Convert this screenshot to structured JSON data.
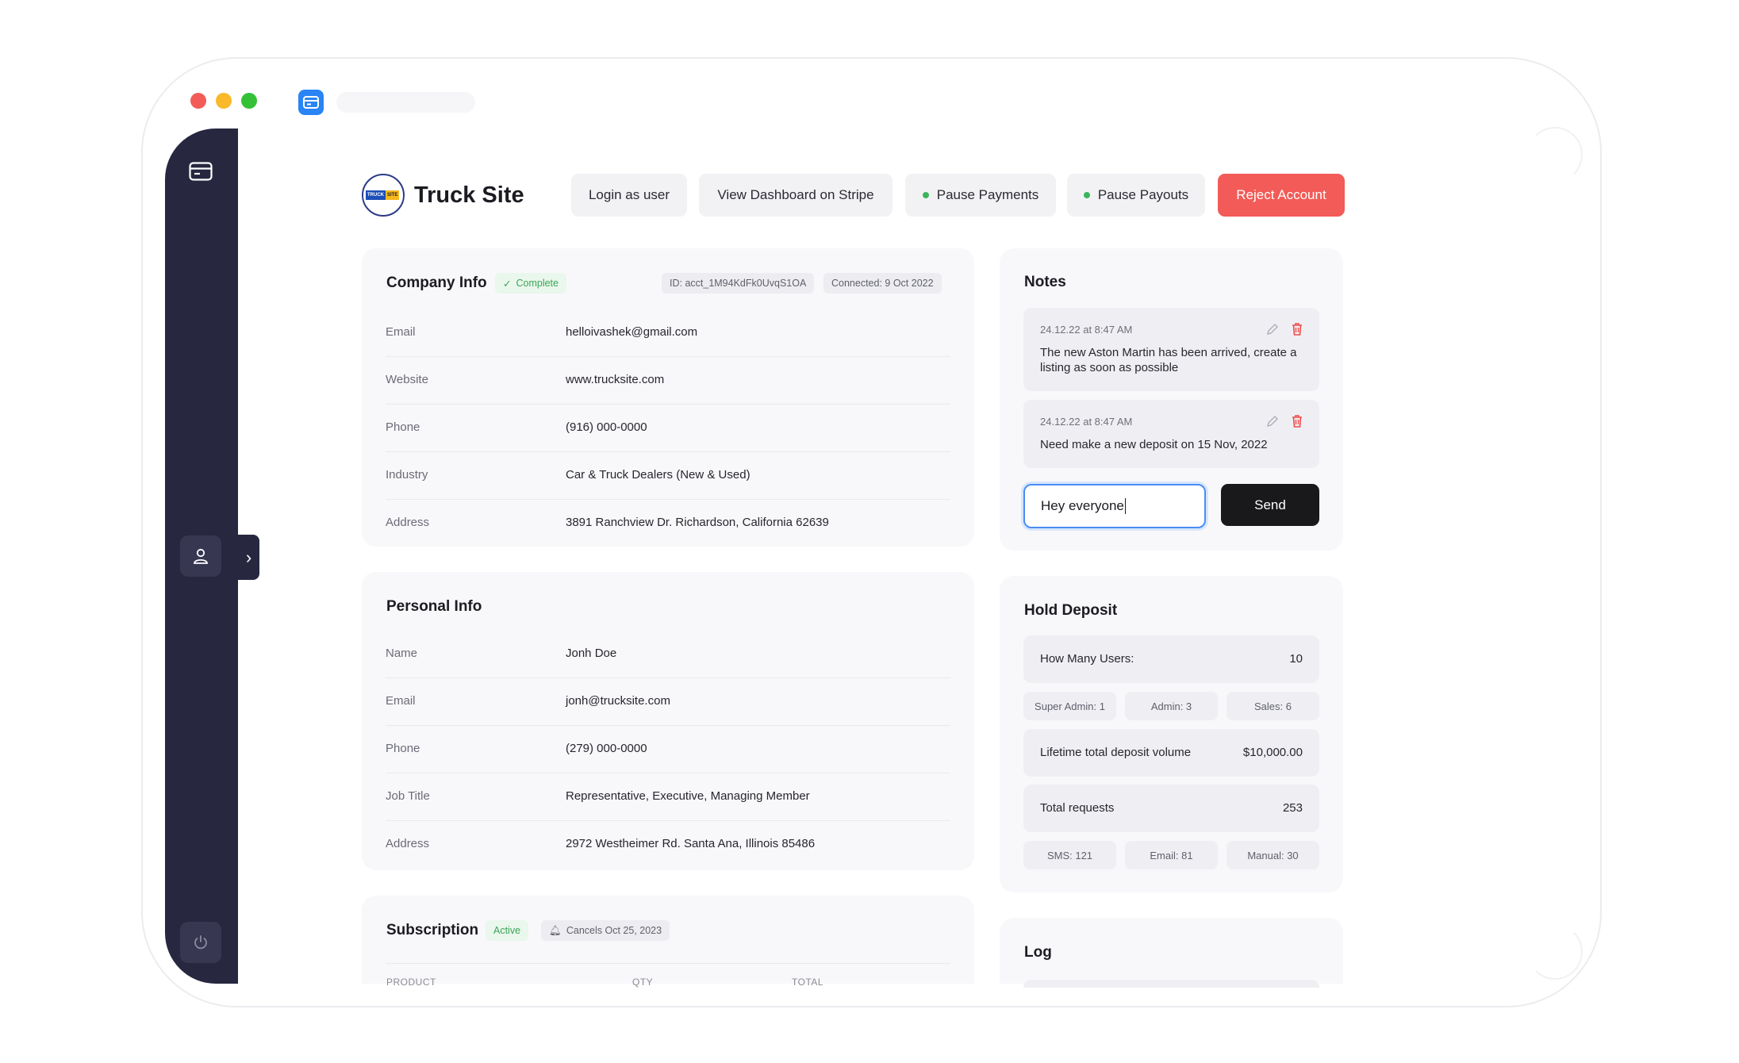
{
  "company": {
    "name": "Truck Site",
    "logo_left": "TRUCK",
    "logo_right": "SITE"
  },
  "actions": {
    "login": "Login as user",
    "stripe": "View Dashboard on Stripe",
    "pause_payments": "Pause Payments",
    "pause_payouts": "Pause Payouts",
    "reject": "Reject Account"
  },
  "company_info": {
    "title": "Company Info",
    "status": "Complete",
    "id": "ID: acct_1M94KdFk0UvqS1OA",
    "connected": "Connected: 9 Oct 2022",
    "rows": [
      {
        "label": "Email",
        "value": "helloivashek@gmail.com"
      },
      {
        "label": "Website",
        "value": "www.trucksite.com"
      },
      {
        "label": "Phone",
        "value": "(916) 000-0000"
      },
      {
        "label": "Industry",
        "value": "Car & Truck Dealers (New & Used)"
      },
      {
        "label": "Address",
        "value": "3891 Ranchview Dr. Richardson, California 62639"
      }
    ]
  },
  "personal_info": {
    "title": "Personal Info",
    "rows": [
      {
        "label": "Name",
        "value": "Jonh Doe"
      },
      {
        "label": "Email",
        "value": "jonh@trucksite.com"
      },
      {
        "label": "Phone",
        "value": "(279) 000-0000"
      },
      {
        "label": "Job Title",
        "value": "Representative, Executive, Managing Member"
      },
      {
        "label": "Address",
        "value": "2972 Westheimer Rd. Santa Ana, Illinois 85486"
      }
    ]
  },
  "subscription": {
    "title": "Subscription",
    "status": "Active",
    "cancels": "Cancels Oct 25, 2023",
    "columns": [
      "PRODUCT",
      "QTY",
      "TOTAL"
    ]
  },
  "notes": {
    "title": "Notes",
    "items": [
      {
        "time": "24.12.22 at 8:47 AM",
        "text": "The new Aston Martin has been arrived, create a listing as soon as possible"
      },
      {
        "time": "24.12.22 at 8:47 AM",
        "text": "Need make a new deposit on 15 Nov, 2022"
      }
    ],
    "input_value": "Hey everyone",
    "send": "Send"
  },
  "hold_deposit": {
    "title": "Hold Deposit",
    "users_label": "How Many Users:",
    "users_value": "10",
    "roles": [
      "Super Admin: 1",
      "Admin: 3",
      "Sales: 6"
    ],
    "lifetime_label": "Lifetime total deposit volume",
    "lifetime_value": "$10,000.00",
    "requests_label": "Total requests",
    "requests_value": "253",
    "channels": [
      "SMS: 121",
      "Email: 81",
      "Manual: 30"
    ]
  },
  "log": {
    "title": "Log"
  }
}
